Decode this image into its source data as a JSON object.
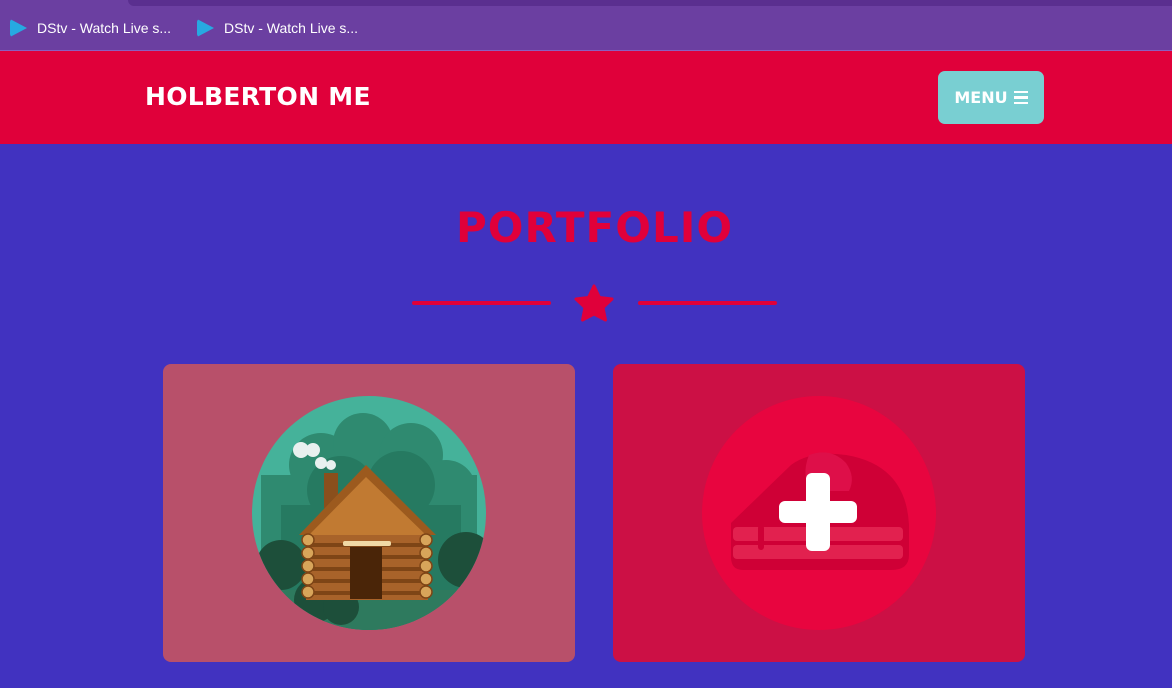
{
  "browser": {
    "bookmarks": [
      {
        "label": "DStv - Watch Live s...",
        "icon": "dstv-play-icon"
      },
      {
        "label": "DStv - Watch Live s...",
        "icon": "dstv-play-icon"
      }
    ]
  },
  "header": {
    "brand": "HOLBERTON ME",
    "menu_label": "MENU",
    "menu_icon": "hamburger-icon"
  },
  "portfolio": {
    "title": "PORTFOLIO",
    "divider_icon": "star-icon",
    "items": [
      {
        "image": "log-cabin-illustration",
        "overlay_icon": ""
      },
      {
        "image": "cake-illustration",
        "overlay_icon": "plus-icon"
      }
    ]
  },
  "colors": {
    "background": "#4132c0",
    "header": "#e0003a",
    "menu_button": "#79cfd2",
    "bookmarks_bar": "#6b3fa1"
  }
}
